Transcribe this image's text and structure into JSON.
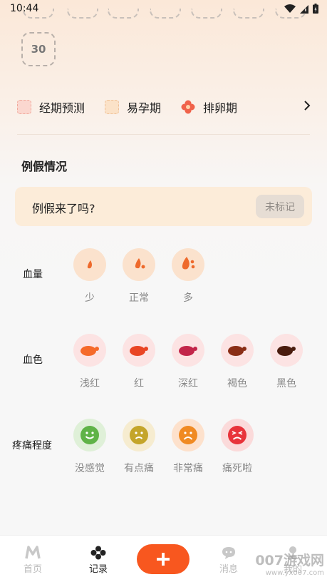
{
  "status": {
    "time": "10:44"
  },
  "calendar": {
    "day_30": "30"
  },
  "legend": [
    {
      "label": "经期预测"
    },
    {
      "label": "易孕期"
    },
    {
      "label": "排卵期"
    }
  ],
  "section": {
    "title": "例假情况"
  },
  "period": {
    "question": "例假来了吗?",
    "button": "未标记"
  },
  "flow": {
    "label": "血量",
    "options": [
      {
        "label": "少"
      },
      {
        "label": "正常"
      },
      {
        "label": "多"
      }
    ]
  },
  "color": {
    "label": "血色",
    "options": [
      {
        "label": "浅红"
      },
      {
        "label": "红"
      },
      {
        "label": "深红"
      },
      {
        "label": "褐色"
      },
      {
        "label": "黑色"
      }
    ]
  },
  "pain": {
    "label": "疼痛程度",
    "options": [
      {
        "label": "没感觉"
      },
      {
        "label": "有点痛"
      },
      {
        "label": "非常痛"
      },
      {
        "label": "痛死啦"
      }
    ]
  },
  "nav": {
    "home": "首页",
    "record": "记录",
    "messages": "消息",
    "mine": "我的"
  },
  "watermark": {
    "brand": "007游戏网",
    "url": "www.yx007.com"
  },
  "colors": {
    "accent": "#f8571f",
    "period": "#fbd7cf",
    "fertile": "#fbe2c8",
    "ovulation": "#f0624a"
  }
}
